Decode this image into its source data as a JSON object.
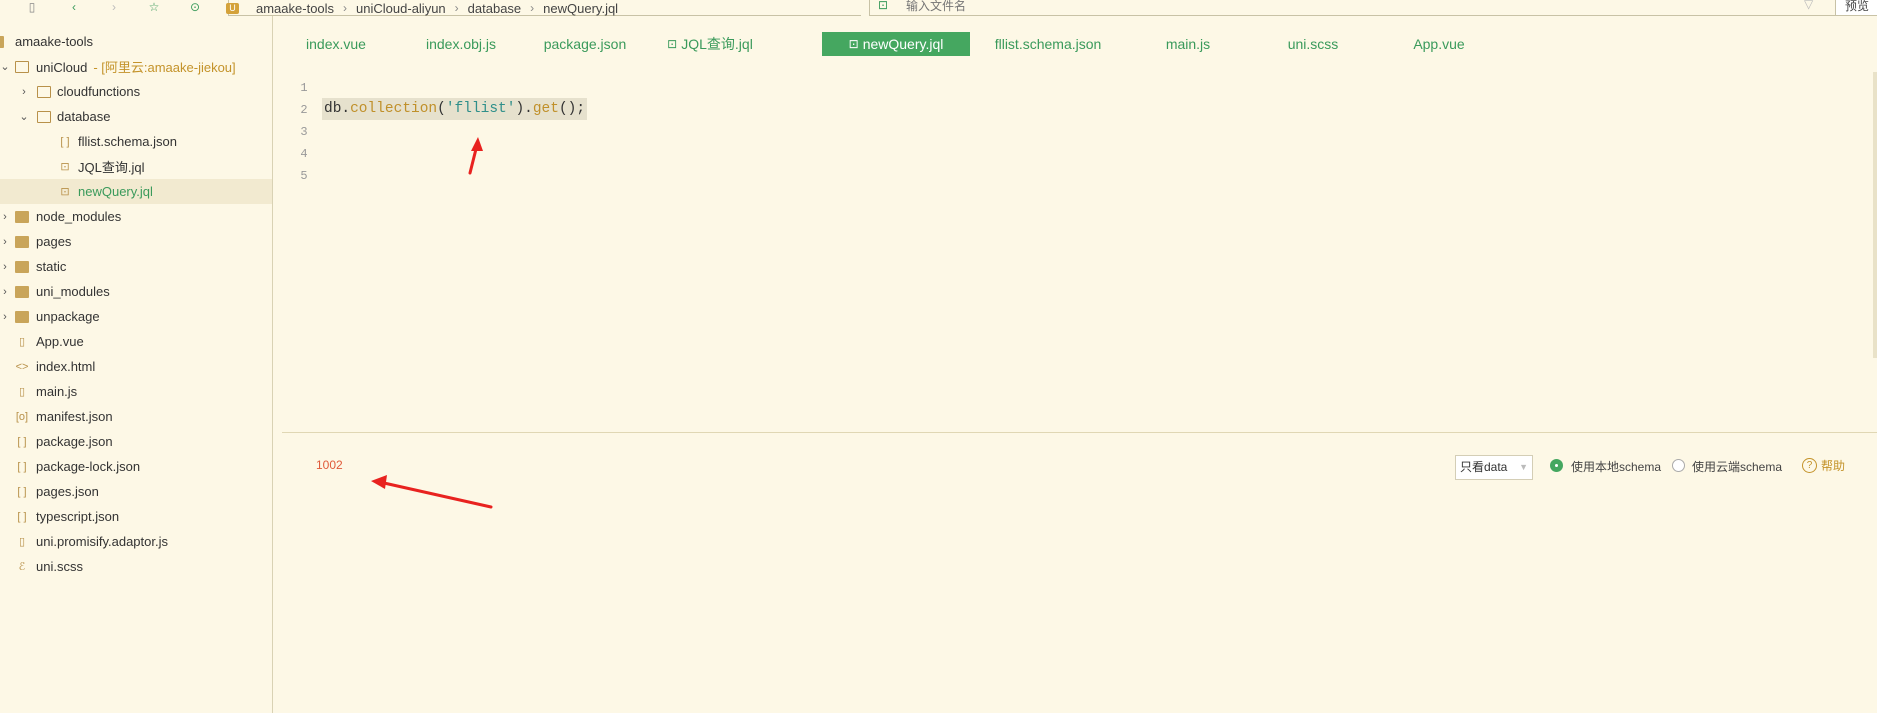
{
  "toolbar": {
    "icons": [
      "file-icon",
      "back-icon",
      "forward-icon",
      "star-icon",
      "run-icon"
    ]
  },
  "breadcrumb": {
    "badge": "U",
    "items": [
      "amaake-tools",
      "uniCloud-aliyun",
      "database",
      "newQuery.jql"
    ]
  },
  "search": {
    "placeholder": "输入文件名"
  },
  "preview_label": "预览",
  "sidebar": {
    "items": [
      {
        "label": "amaake-tools",
        "suffix": ""
      },
      {
        "label": "uniCloud",
        "suffix": "- [阿里云:amaake-jiekou]"
      },
      {
        "label": "cloudfunctions",
        "suffix": ""
      },
      {
        "label": "database",
        "suffix": ""
      },
      {
        "label": "fllist.schema.json",
        "suffix": ""
      },
      {
        "label": "JQL查询.jql",
        "suffix": ""
      },
      {
        "label": "newQuery.jql",
        "suffix": ""
      },
      {
        "label": "node_modules",
        "suffix": ""
      },
      {
        "label": "pages",
        "suffix": ""
      },
      {
        "label": "static",
        "suffix": ""
      },
      {
        "label": "uni_modules",
        "suffix": ""
      },
      {
        "label": "unpackage",
        "suffix": ""
      },
      {
        "label": "App.vue",
        "suffix": ""
      },
      {
        "label": "index.html",
        "suffix": ""
      },
      {
        "label": "main.js",
        "suffix": ""
      },
      {
        "label": "manifest.json",
        "suffix": ""
      },
      {
        "label": "package.json",
        "suffix": ""
      },
      {
        "label": "package-lock.json",
        "suffix": ""
      },
      {
        "label": "pages.json",
        "suffix": ""
      },
      {
        "label": "typescript.json",
        "suffix": ""
      },
      {
        "label": "uni.promisify.adaptor.js",
        "suffix": ""
      },
      {
        "label": "uni.scss",
        "suffix": ""
      }
    ]
  },
  "tabs": [
    {
      "label": "index.vue"
    },
    {
      "label": "index.obj.js"
    },
    {
      "label": "package.json"
    },
    {
      "label": "JQL查询.jql"
    },
    {
      "label": "newQuery.jql"
    },
    {
      "label": "fllist.schema.json"
    },
    {
      "label": "main.js"
    },
    {
      "label": "uni.scss"
    },
    {
      "label": "App.vue"
    }
  ],
  "editor": {
    "line_numbers": [
      "1",
      "2",
      "3",
      "4",
      "5"
    ],
    "code": {
      "obj": "db",
      "dot1": ".",
      "fn1": "collection",
      "open1": "(",
      "str": "'fllist'",
      "close1": ")",
      "dot2": ".",
      "fn2": "get",
      "tail": "();"
    }
  },
  "result": {
    "value": "1002"
  },
  "controls": {
    "select_value": "只看data",
    "radio_local": "使用本地schema",
    "radio_cloud": "使用云端schema",
    "help": "帮助",
    "help_icon": "?"
  },
  "colors": {
    "accent": "#45a760",
    "arrow": "#e8221f",
    "background": "#fdf8e6"
  }
}
